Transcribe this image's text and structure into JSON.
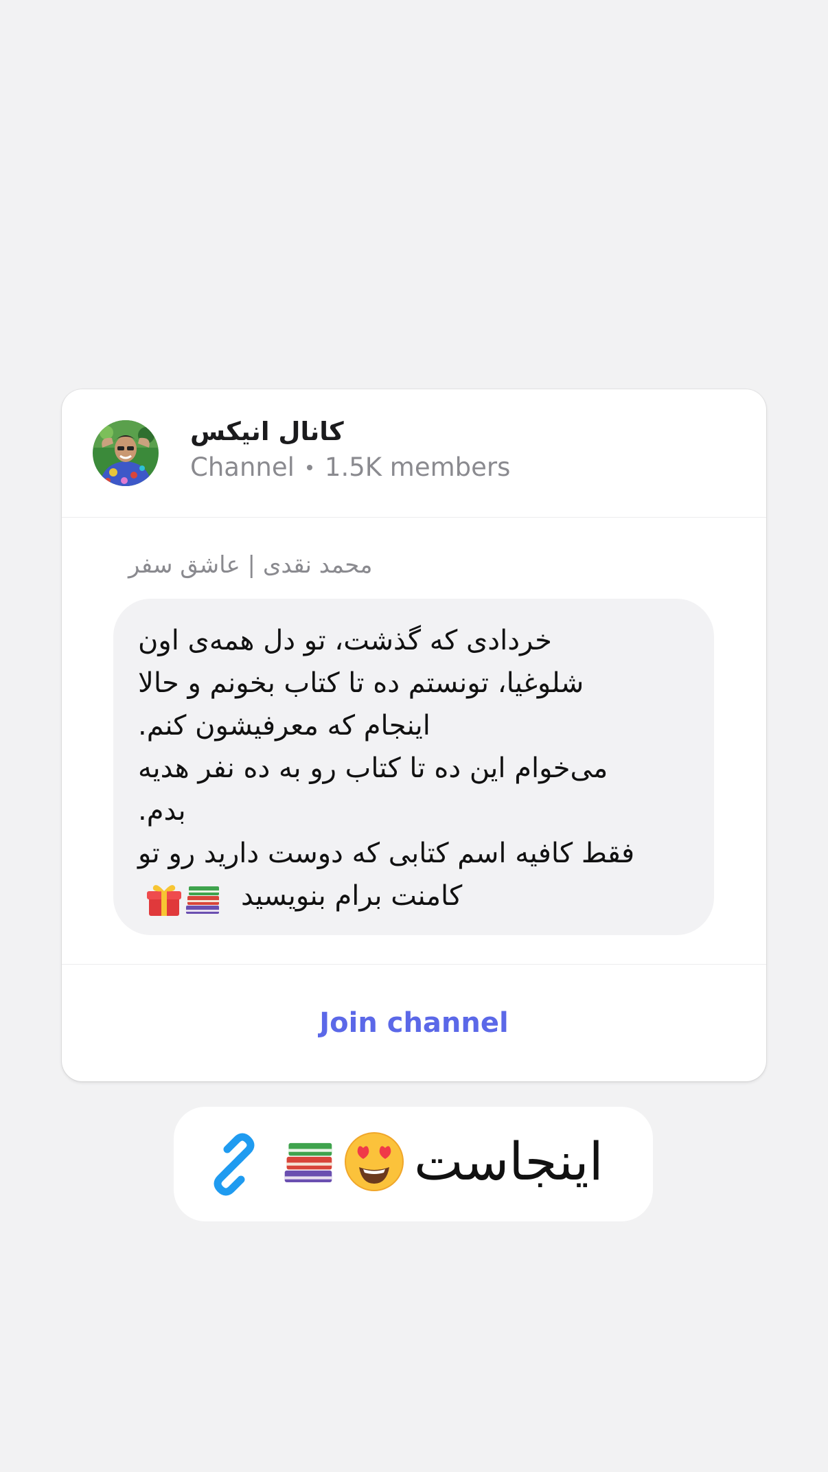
{
  "channel": {
    "name": "کانال انیکس",
    "type_label": "Channel",
    "members": "1.5K members",
    "avatar": "profile-photo"
  },
  "post": {
    "author": "محمد نقدی | عاشق سفر",
    "lines": [
      "خردادی که گذشت، تو دل همه‌ی اون",
      "شلوغیا، تونستم ده تا کتاب بخونم و حالا",
      "اینجام که معرفیشون کنم.",
      "می‌خوام این ده تا کتاب رو به ده نفر هدیه",
      "بدم.",
      "فقط کافیه اسم کتابی که دوست دارید رو تو",
      "کامنت برام بنویسید"
    ],
    "last_line_icons": [
      "gift-icon",
      "books-icon"
    ]
  },
  "actions": {
    "join_label": "Join channel",
    "accent": "#5b68e8"
  },
  "sticker": {
    "text": "اینجاست",
    "icons": [
      "heart-eyes-icon",
      "books-icon",
      "link-icon"
    ]
  }
}
